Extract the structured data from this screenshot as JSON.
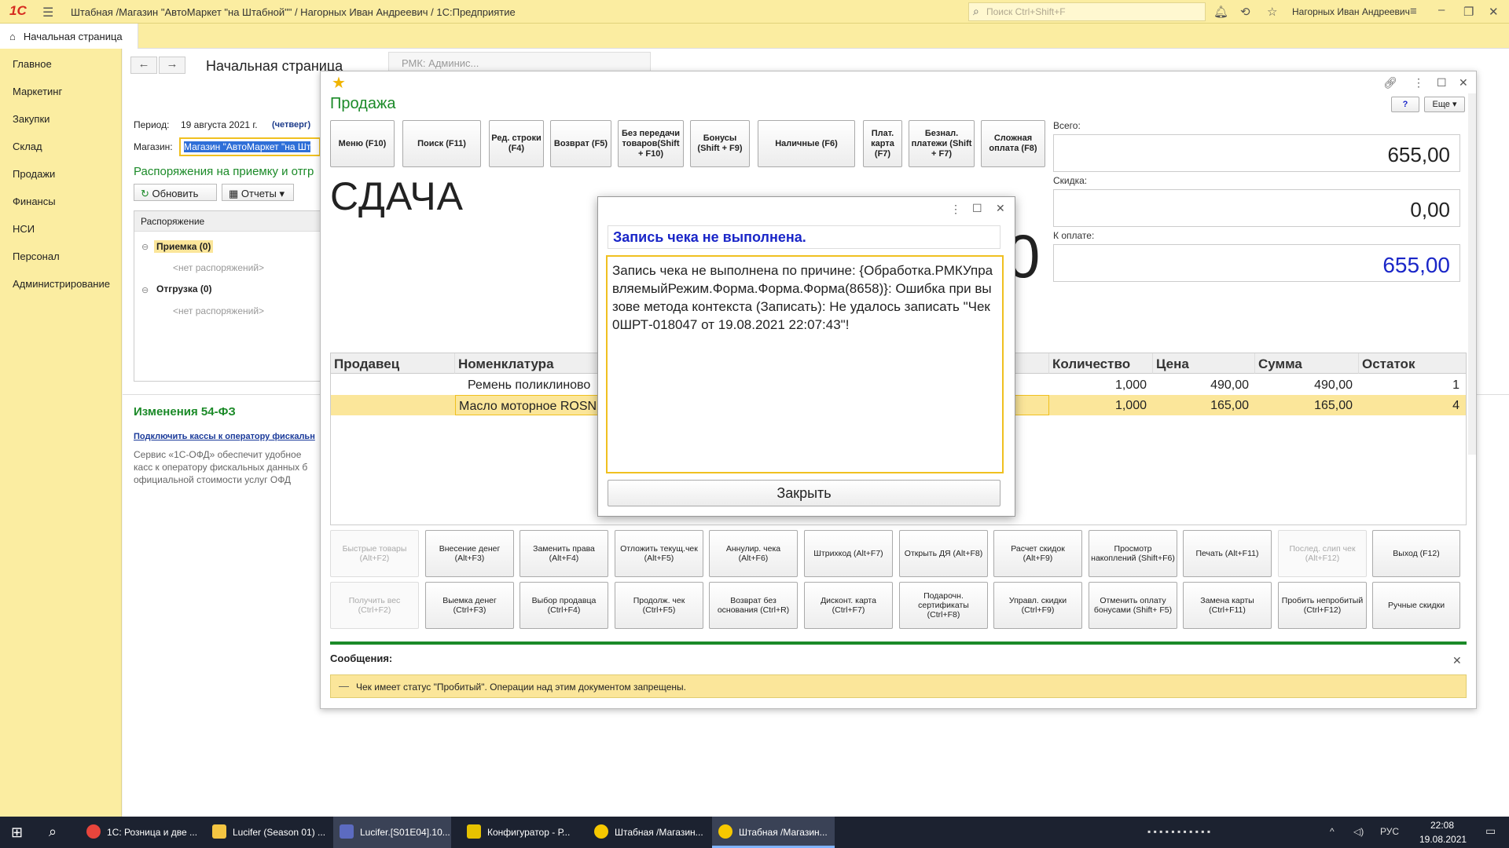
{
  "app": {
    "logo": "1С",
    "window_title": "Штабная /Магазин \"АвтоМаркет \"на Штабной\"\" / Нагорных Иван Андреевич / 1С:Предприятие",
    "search_placeholder": "Поиск Ctrl+Shift+F",
    "user": "Нагорных Иван Андреевич"
  },
  "home_tab": "Начальная страница",
  "sidebar": [
    "Главное",
    "Маркетинг",
    "Закупки",
    "Склад",
    "Продажи",
    "Финансы",
    "НСИ",
    "Персонал",
    "Администрирование"
  ],
  "start_page": {
    "title": "Начальная страница",
    "background_tab": "РМК: Админис...",
    "period_label": "Период:",
    "period_value": "19 августа 2021 г.",
    "period_day": "(четверг)",
    "store_label": "Магазин:",
    "store_value": "Магазин \"АвтоМаркет \"на Шт",
    "orders_title": "Распоряжения на приемку и отгр",
    "refresh_btn": "Обновить",
    "reports_btn": "Отчеты",
    "orders_header": "Распоряжение",
    "receiving": "Приемка (0)",
    "no_orders_1": "<нет распоряжений>",
    "shipping": "Отгрузка (0)",
    "no_orders_2": "<нет распоряжений>",
    "changes_title": "Изменения 54-ФЗ",
    "connect_link": "Подключить кассы к оператору фискальн",
    "desc_1": "Сервис «1С-ОФД» обеспечит удобное",
    "desc_2": "касс к оператору фискальных данных б",
    "desc_3": "официальной стоимости услуг ОФД"
  },
  "sale": {
    "title": "Продажа",
    "help_btn": "?",
    "more_btn": "Еще",
    "fkeys": [
      "Меню (F10)",
      "Поиск (F11)",
      "Ред. строки (F4)",
      "Возврат (F5)",
      "Без передачи товаров(Shift + F10)",
      "Бонусы (Shift + F9)",
      "Наличные (F6)",
      "Плат. карта (F7)",
      "Безнал. платежи (Shift + F7)",
      "Сложная оплата (F8)"
    ],
    "change_label": "СДАЧА",
    "change_value_tail": "0",
    "total_label": "Всего:",
    "total_value": "655,00",
    "discount_label": "Скидка:",
    "discount_value": "0,00",
    "topay_label": "К оплате:",
    "topay_value": "655,00",
    "table": {
      "headers": [
        "Продавец",
        "Номенклатура",
        "Количество",
        "Цена",
        "Сумма",
        "Остаток"
      ],
      "rows": [
        {
          "seller": "",
          "item": "Ремень поликлиново",
          "qty": "1,000",
          "price": "490,00",
          "sum": "490,00",
          "rest": "1"
        },
        {
          "seller": "",
          "item": "Масло моторное  ROSN",
          "qty": "1,000",
          "price": "165,00",
          "sum": "165,00",
          "rest": "4"
        }
      ]
    },
    "buttons_row1": [
      "Быстрые товары (Alt+F2)",
      "Внесение денег (Alt+F3)",
      "Заменить права (Alt+F4)",
      "Отложить текущ.чек (Alt+F5)",
      "Аннулир. чека (Alt+F6)",
      "Штрихкод (Alt+F7)",
      "Открыть ДЯ (Alt+F8)",
      "Расчет скидок (Alt+F9)",
      "Просмотр накоплений (Shift+F6)",
      "Печать (Alt+F11)",
      "Послед. слип чек (Alt+F12)",
      "Выход (F12)"
    ],
    "buttons_row2": [
      "Получить вес (Ctrl+F2)",
      "Выемка денег (Ctrl+F3)",
      "Выбор продавца (Ctrl+F4)",
      "Продолж. чек (Ctrl+F5)",
      "Возврат без основания (Ctrl+R)",
      "Дисконт. карта (Ctrl+F7)",
      "Подарочн. сертификаты (Ctrl+F8)",
      "Управл. скидки (Ctrl+F9)",
      "Отменить оплату бонусами (Shift+ F5)",
      "Замена карты (Ctrl+F11)",
      "Пробить непробитый (Ctrl+F12)",
      "Ручные скидки"
    ],
    "messages_label": "Сообщения:",
    "message": "Чек имеет статус \"Пробитый\". Операции над этим документом запрещены."
  },
  "dialog": {
    "header": "Запись чека не выполнена.",
    "body": "Запись чека не выполнена по причине: {Обработка.РМКУправляемыйРежим.Форма.Форма.Форма(8658)}: Ошибка при вызове метода контекста (Записать): Не удалось записать \"Чек 0ШРТ-018047 от 19.08.2021 22:07:43\"!",
    "close_btn": "Закрыть"
  },
  "taskbar": {
    "items": [
      "1С: Розница и две ...",
      "Lucifer (Season 01) ...",
      "Lucifer.[S01E04].10...",
      "Конфигуратор - Р...",
      "Штабная /Магазин...",
      "Штабная /Магазин..."
    ],
    "lang": "РУС",
    "time": "22:08",
    "date": "19.08.2021"
  },
  "colors": {
    "accent_green": "#1b8a28",
    "yellow": "#fbeda1",
    "blue": "#1a26c8"
  }
}
